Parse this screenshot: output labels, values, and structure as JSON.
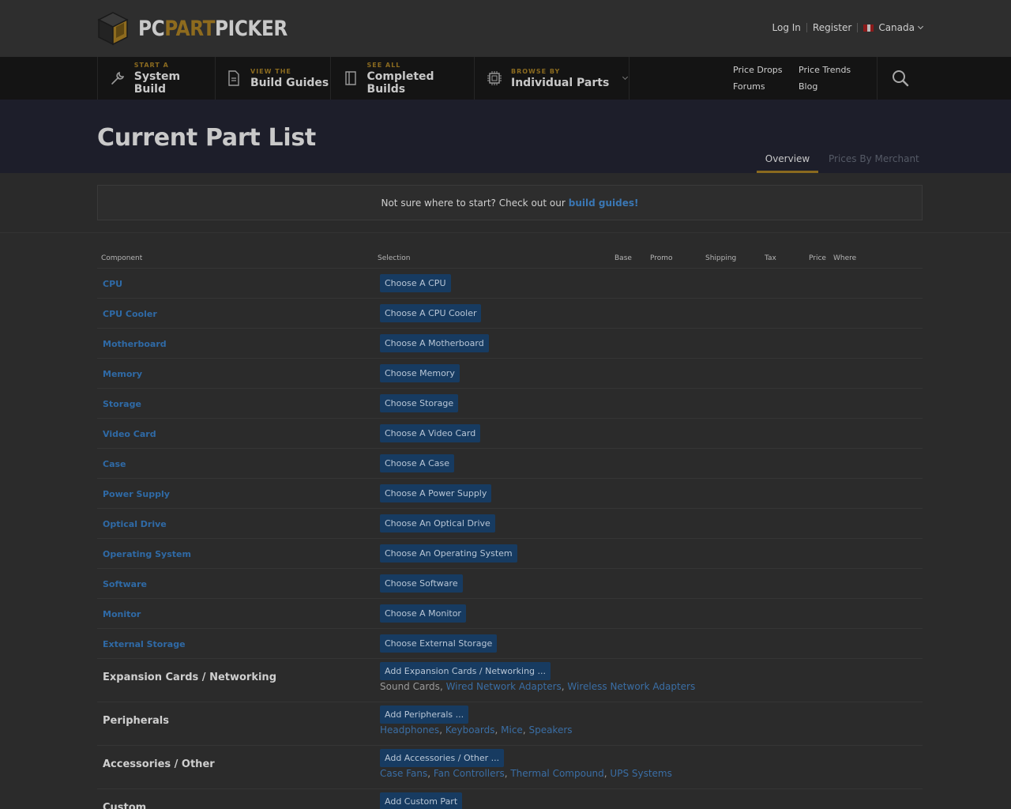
{
  "header": {
    "logo": {
      "pc": "PC",
      "part": "PART",
      "picker": "PICKER"
    },
    "login": "Log In",
    "register": "Register",
    "country": "Canada"
  },
  "nav": {
    "items": [
      {
        "small": "START A",
        "label": "System Build",
        "icon": "wrench-icon"
      },
      {
        "small": "VIEW THE",
        "label": "Build Guides",
        "icon": "document-icon"
      },
      {
        "small": "SEE ALL",
        "label": "Completed Builds",
        "icon": "book-icon"
      },
      {
        "small": "BROWSE BY",
        "label": "Individual Parts",
        "icon": "chip-icon"
      }
    ],
    "links": [
      "Price Drops",
      "Price Trends",
      "Forums",
      "Blog"
    ]
  },
  "page": {
    "title": "Current Part List",
    "tabs": [
      "Overview",
      "Prices By Merchant"
    ],
    "active_tab": "Overview"
  },
  "notice": {
    "text": "Not sure where to start? Check out our",
    "link": "build guides!"
  },
  "table": {
    "headers": [
      "Component",
      "Selection",
      "Base",
      "Promo",
      "Shipping",
      "Tax",
      "Price",
      "Where"
    ],
    "rows": [
      {
        "component": "CPU",
        "button": "Choose A CPU"
      },
      {
        "component": "CPU Cooler",
        "button": "Choose A CPU Cooler"
      },
      {
        "component": "Motherboard",
        "button": "Choose A Motherboard"
      },
      {
        "component": "Memory",
        "button": "Choose Memory"
      },
      {
        "component": "Storage",
        "button": "Choose Storage"
      },
      {
        "component": "Video Card",
        "button": "Choose A Video Card"
      },
      {
        "component": "Case",
        "button": "Choose A Case"
      },
      {
        "component": "Power Supply",
        "button": "Choose A Power Supply"
      },
      {
        "component": "Optical Drive",
        "button": "Choose An Optical Drive"
      },
      {
        "component": "Operating System",
        "button": "Choose An Operating System"
      },
      {
        "component": "Software",
        "button": "Choose Software"
      },
      {
        "component": "Monitor",
        "button": "Choose A Monitor"
      },
      {
        "component": "External Storage",
        "button": "Choose External Storage"
      }
    ],
    "extra_rows": [
      {
        "category": "Expansion Cards / Networking",
        "button": "Add Expansion Cards / Networking ...",
        "plain": [
          "Sound Cards"
        ],
        "links": [
          "Wired Network Adapters",
          "Wireless Network Adapters"
        ]
      },
      {
        "category": "Peripherals",
        "button": "Add Peripherals ...",
        "plain": [],
        "links": [
          "Headphones",
          "Keyboards",
          "Mice",
          "Speakers"
        ]
      },
      {
        "category": "Accessories / Other",
        "button": "Add Accessories / Other ...",
        "plain": [],
        "links": [
          "Case Fans",
          "Fan Controllers",
          "Thermal Compound",
          "UPS Systems"
        ]
      },
      {
        "category": "Custom",
        "button": "Add Custom Part",
        "plain": [],
        "links": []
      }
    ]
  },
  "colors": {
    "link": "#2f6aa6",
    "accent": "#8a6a1f",
    "button_bg": "#173b61",
    "nav_bg": "#141414",
    "band_bg": "#1d1e2a"
  }
}
